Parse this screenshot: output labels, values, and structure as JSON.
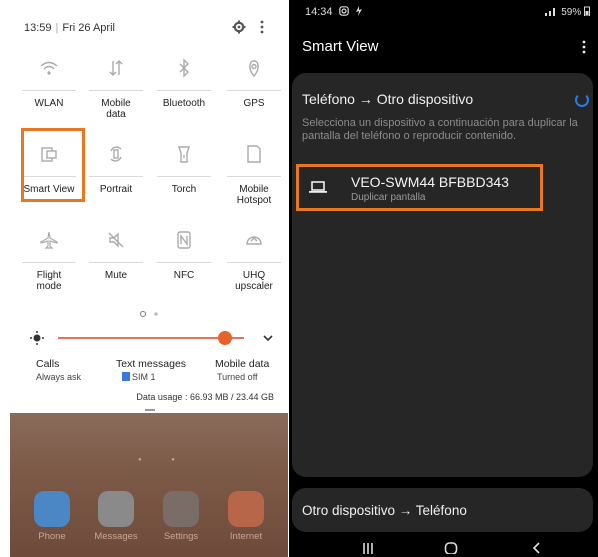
{
  "left": {
    "status": {
      "time": "13:59",
      "separator": "|",
      "date": "Fri 26 April"
    },
    "tiles": [
      {
        "name": "wifi",
        "label": "WLAN"
      },
      {
        "name": "mobile-data",
        "label": "Mobile\ndata"
      },
      {
        "name": "bluetooth",
        "label": "Bluetooth"
      },
      {
        "name": "gps",
        "label": "GPS"
      },
      {
        "name": "smart-view",
        "label": "Smart View"
      },
      {
        "name": "portrait",
        "label": "Portrait"
      },
      {
        "name": "torch",
        "label": "Torch"
      },
      {
        "name": "mobile-hotspot",
        "label": "Mobile\nHotspot"
      },
      {
        "name": "flight-mode",
        "label": "Flight\nmode"
      },
      {
        "name": "mute",
        "label": "Mute"
      },
      {
        "name": "nfc",
        "label": "NFC"
      },
      {
        "name": "uhq-upscaler",
        "label": "UHQ\nupscaler"
      }
    ],
    "brightness": 0.9,
    "info": {
      "calls_title": "Calls",
      "calls_sub": "Always ask",
      "text_title": "Text messages",
      "text_sub": "SIM 1",
      "data_title": "Mobile data",
      "data_sub": "Turned off"
    },
    "data_usage": "Data usage : 66.93 MB / 23.44 GB",
    "dock": [
      {
        "label": "Phone",
        "color": "#4b86c5"
      },
      {
        "label": "Messages",
        "color": "#8a8a8a"
      },
      {
        "label": "Settings",
        "color": "#7a6d68"
      },
      {
        "label": "Internet",
        "color": "#b8664a"
      }
    ]
  },
  "right": {
    "status": {
      "time": "14:34",
      "battery": "59%"
    },
    "title": "Smart View",
    "section_heading": "Teléfono → Otro dispositivo",
    "description": "Selecciona un dispositivo a continuación para duplicar la pantalla del teléfono o reproducir contenido.",
    "device": {
      "name": "VEO-SWM44 BFBBD343",
      "subtitle": "Duplicar pantalla"
    },
    "reverse_option": "Otro dispositivo → Teléfono"
  },
  "colors": {
    "highlight": "#e87722",
    "accent": "#2a7be4"
  }
}
